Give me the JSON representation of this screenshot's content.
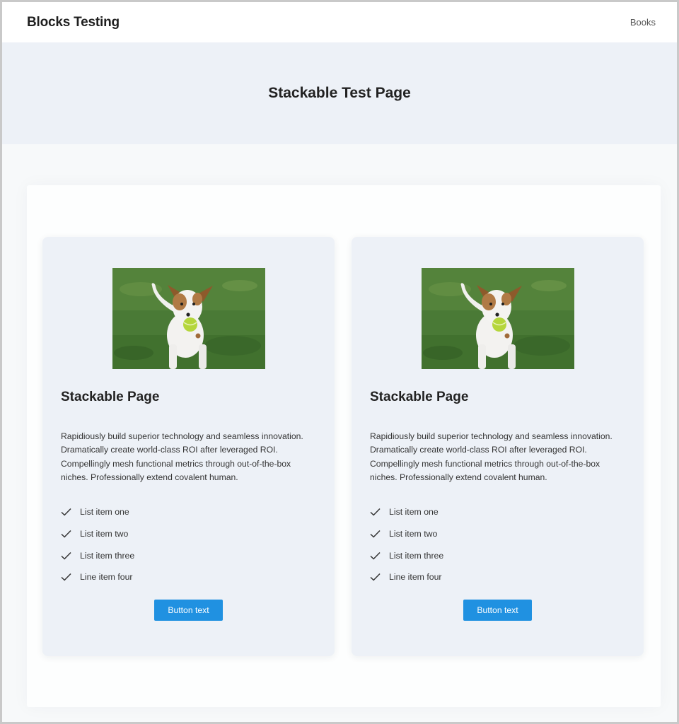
{
  "header": {
    "site_title": "Blocks Testing",
    "nav": [
      {
        "label": "Books"
      }
    ]
  },
  "hero": {
    "title": "Stackable Test Page"
  },
  "cards": [
    {
      "image_icon": "dog-photo",
      "title": "Stackable Page",
      "body": "Rapidiously build superior technology and seamless innovation. Dramatically create world-class ROI after leveraged ROI. Compellingly mesh functional metrics through out-of-the-box niches. Professionally extend covalent human.",
      "list": [
        "List item one",
        "List item two",
        "List item three",
        "Line item four"
      ],
      "button_label": "Button text"
    },
    {
      "image_icon": "dog-photo",
      "title": "Stackable Page",
      "body": "Rapidiously build superior technology and seamless innovation. Dramatically create world-class ROI after leveraged ROI. Compellingly mesh functional metrics through out-of-the-box niches. Professionally extend covalent human.",
      "list": [
        "List item one",
        "List item two",
        "List item three",
        "Line item four"
      ],
      "button_label": "Button text"
    }
  ],
  "colors": {
    "accent": "#2091e1",
    "hero_bg": "#edf1f7",
    "page_bg": "#f7f9fa"
  }
}
